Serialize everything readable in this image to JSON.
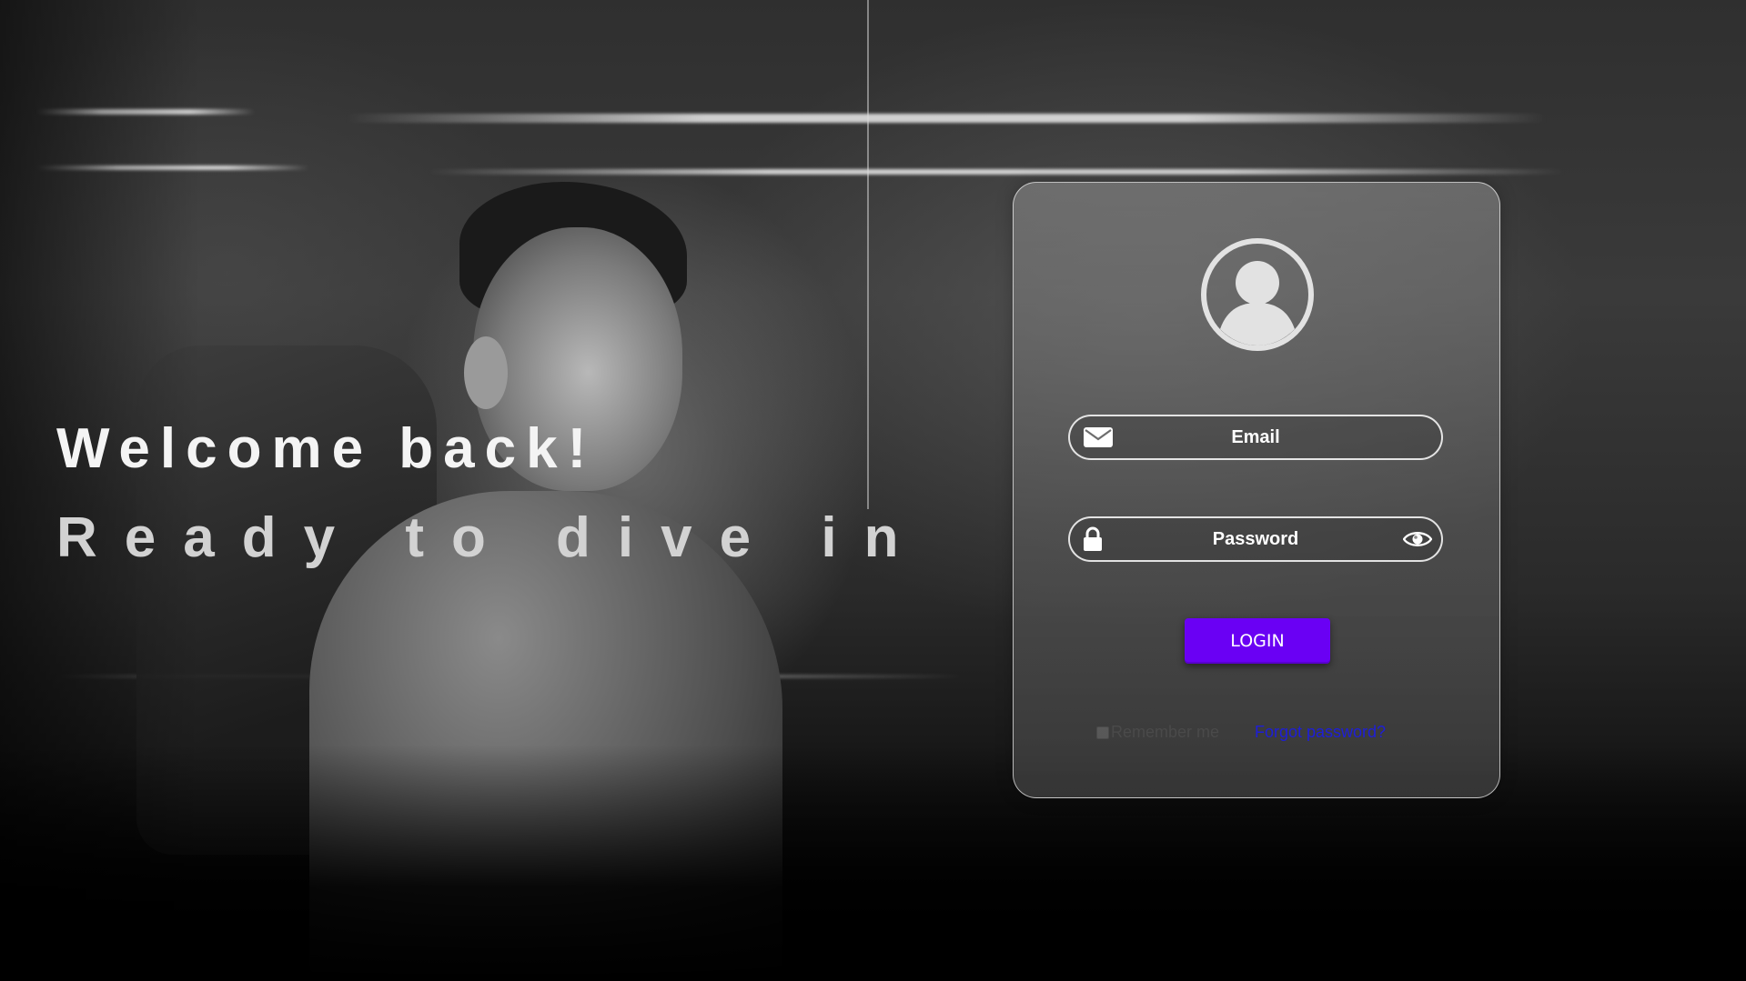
{
  "hero": {
    "welcome": "Welcome back!",
    "tagline": "Ready to dive in"
  },
  "login": {
    "avatar_icon": "user-avatar-icon",
    "email_label": "Email",
    "email_icon": "envelope-icon",
    "password_label": "Password",
    "password_icon": "lock-icon",
    "show_password_icon": "eye-icon",
    "login_button": "LOGIN",
    "remember_label": "Remember me",
    "remember_checked": false,
    "forgot_link": "Forgot password?"
  },
  "colors": {
    "accent": "#6a00f4",
    "link": "#1e1ed8",
    "card_border": "#e6e6e6"
  }
}
